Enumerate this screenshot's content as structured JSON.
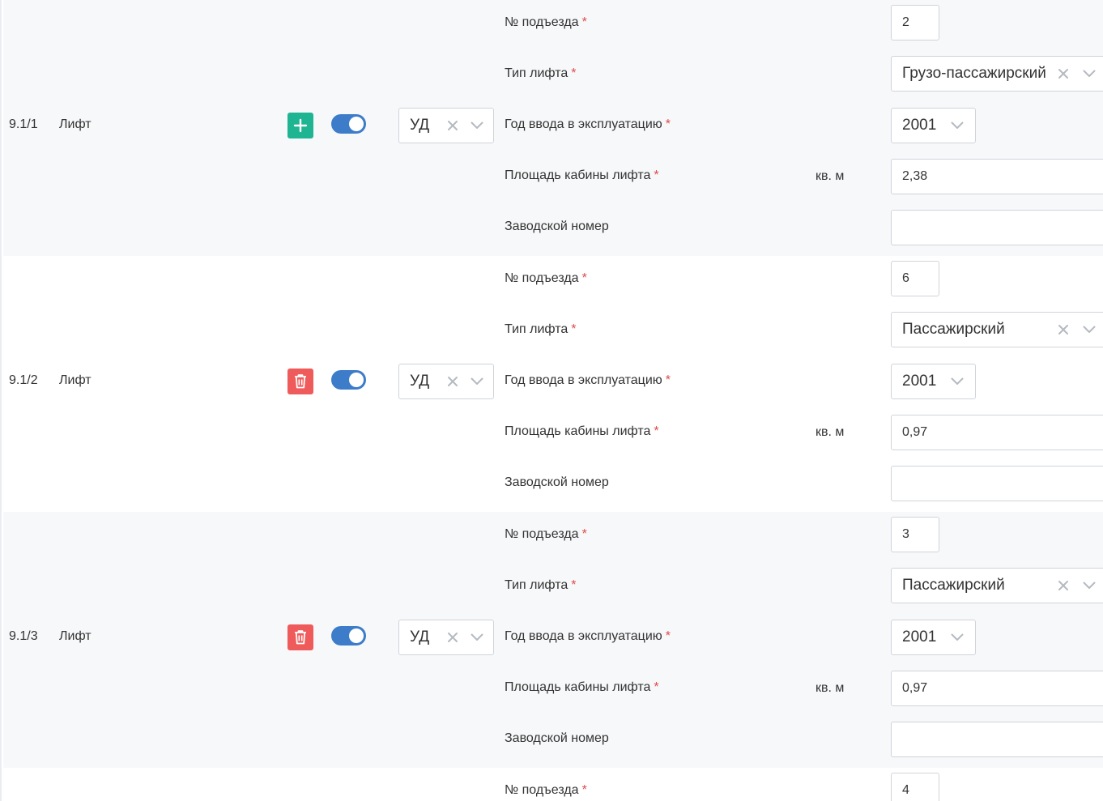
{
  "lifts": [
    {
      "code": "9.1/1",
      "name": "Лифт",
      "action": "add",
      "management": "УД",
      "entrance": "2",
      "lift_type": "Грузо-пассажирский",
      "year": "2001",
      "cabin_area": "2,38",
      "serial_number": ""
    },
    {
      "code": "9.1/2",
      "name": "Лифт",
      "action": "delete",
      "management": "УД",
      "entrance": "6",
      "lift_type": "Пассажирский",
      "year": "2001",
      "cabin_area": "0,97",
      "serial_number": ""
    },
    {
      "code": "9.1/3",
      "name": "Лифт",
      "action": "delete",
      "management": "УД",
      "entrance": "3",
      "lift_type": "Пассажирский",
      "year": "2001",
      "cabin_area": "0,97",
      "serial_number": ""
    },
    {
      "entrance": "4"
    }
  ],
  "labels": {
    "entrance": "№ подъезда",
    "lift_type": "Тип лифта",
    "year": "Год ввода в эксплуатацию",
    "cabin_area": "Площадь кабины лифта",
    "serial_number": "Заводской номер",
    "area_unit": "кв. м",
    "required_mark": "*"
  },
  "colors": {
    "add_button": "#1fb592",
    "delete_button": "#ef5b5b",
    "toggle_on": "#3d7cc9",
    "required_mark": "#e04a4a",
    "row_shade": "#f7f8fa"
  },
  "icons": {
    "add": "plus-icon",
    "delete": "trash-icon",
    "clear": "close-icon",
    "dropdown": "chevron-down-icon"
  }
}
